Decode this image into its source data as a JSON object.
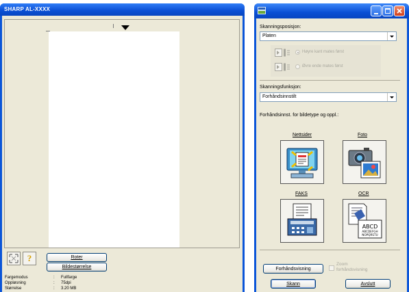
{
  "left_window": {
    "title": "SHARP AL-XXXX",
    "rotate_label": "Roter",
    "image_size_label": "Bildestørrelse",
    "help_glyph": "?",
    "info": [
      {
        "key": "Fargemodus",
        "sep": ":",
        "value": "Fullfarge"
      },
      {
        "key": "Oppløsning",
        "sep": ":",
        "value": "75dpi"
      },
      {
        "key": "Størrelse",
        "sep": ":",
        "value": "3.20 MB"
      }
    ]
  },
  "right_window": {
    "scan_position_label": "Skanningsposisjon:",
    "scan_position_value": "Platen",
    "feed_option_1": "Høyre kant mates først",
    "feed_option_2": "Øvre ende mates først",
    "scan_function_label": "Skanningsfunksjon:",
    "scan_function_value": "Forhåndsinnstilt",
    "preset_caption": "Forhåndsinnst. for bildetype og oppl.:",
    "presets": [
      {
        "label": "Nettsider",
        "icon": "web-monitor-icon"
      },
      {
        "label": "Foto",
        "icon": "camera-photo-icon"
      },
      {
        "label": "FAKS",
        "icon": "fax-machine-icon"
      },
      {
        "label": "OCR",
        "icon": "ocr-document-icon"
      }
    ],
    "preview_button": "Forhåndsvisning",
    "zoom_label_1": "Zoom",
    "zoom_label_2": "forhåndsvisning",
    "scan_button": "Skann",
    "exit_button": "Avslutt"
  },
  "colors": {
    "xp_titlebar": "#0a4fd4",
    "dialog_face": "#ece9d8",
    "close_button": "#e0502c"
  }
}
